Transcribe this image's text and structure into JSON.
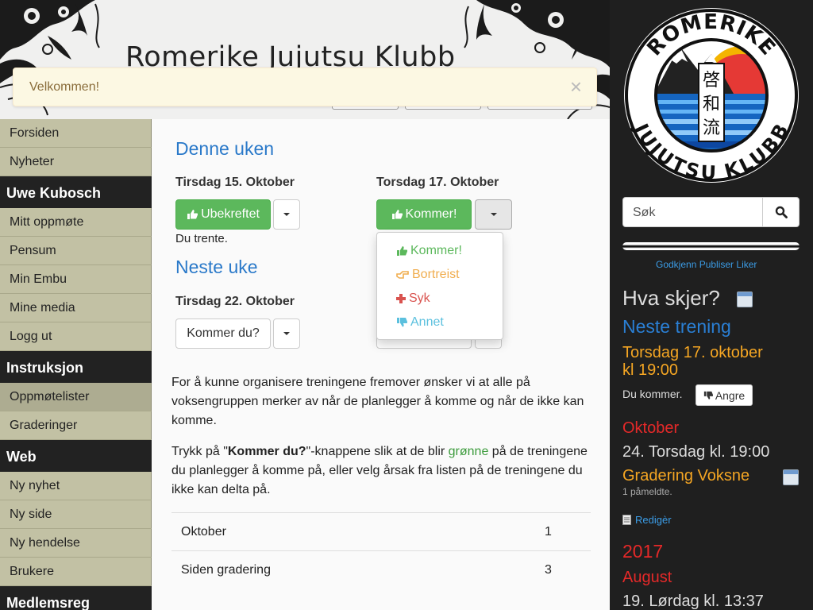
{
  "header": {
    "site_title": "Romerike Jujutsu Klubb"
  },
  "alert": {
    "message": "Velkommen!",
    "close_symbol": "×"
  },
  "leftnav": {
    "top_items": [
      "Forsiden",
      "Nyheter"
    ],
    "sections": [
      {
        "title": "Uwe Kubosch",
        "items": [
          "Mitt oppmøte",
          "Pensum",
          "Min Embu",
          "Mine media",
          "Logg ut"
        ]
      },
      {
        "title": "Instruksjon",
        "items": [
          "Oppmøtelister",
          "Graderinger"
        ]
      },
      {
        "title": "Web",
        "items": [
          "Ny nyhet",
          "Ny side",
          "Ny hendelse",
          "Brukere"
        ]
      },
      {
        "title": "Medlemsreg"
      }
    ],
    "active_item": "Oppmøtelister"
  },
  "main": {
    "this_week": "Denne uken",
    "tuesday_15": "Tirsdag 15. Oktober",
    "thursday_17": "Torsdag 17. Oktober",
    "btn_unconfirmed": "Ubekreftet",
    "btn_coming": "Kommer!",
    "trained_text": "Du trente.",
    "next_week": "Neste uke",
    "tuesday_22": "Tirsdag 22. Oktober",
    "btn_coming_q": "Kommer du?",
    "dropdown": {
      "coming": "Kommer!",
      "away": "Bortreist",
      "sick": "Syk",
      "other": "Annet"
    },
    "para1": "For å kunne organisere treningene fremover ønsker vi at alle på voksengruppen merker av når de planlegger å komme og når de ikke kan komme.",
    "para2": {
      "prefix": "Trykk på \"",
      "bold": "Kommer du?",
      "mid": "\"-knappene slik at de blir ",
      "green_word": "grønne",
      "suffix": " på de treningene du planlegger å komme på, eller velg årsak fra listen på de treningene du ikke kan delta på."
    },
    "stats": [
      {
        "label": "Oktober",
        "value": "1"
      },
      {
        "label": "Siden gradering",
        "value": "3"
      }
    ]
  },
  "sidebar": {
    "logo": {
      "top_text": "ROMERIKE",
      "bottom_text": "JUJUTSU KLUBB",
      "kanji": [
        "啓",
        "和",
        "流"
      ]
    },
    "search_placeholder": "Søk",
    "fb_links": "Godkjenn Publiser Liker",
    "whats_on": "Hva skjer?",
    "next_training": "Neste trening",
    "next_training_time_1": "Torsdag 17. oktober",
    "next_training_time_2": "kl 19:00",
    "you_coming": "Du kommer.",
    "undo_button": "Angre",
    "month": "Oktober",
    "event_line": "24. Torsdag kl. 19:00",
    "event_title": "Gradering Voksne",
    "registered": "1 påmeldte.",
    "edit_link": "Redigèr",
    "year": "2017",
    "month2": "August",
    "event_line2": "19. Lørdag kl. 13:37"
  },
  "colors": {
    "accent_blue": "#2a79c9",
    "success_green": "#5cb85c",
    "warning_orange": "#f5a623",
    "danger_red": "#e52929",
    "info_blue": "#5bc0de",
    "nav_olive": "#c2c1a4",
    "dark": "#222222"
  },
  "icons": [
    "thumbs-up-icon",
    "thumbs-down-icon",
    "hand-point-icon",
    "plus-icon",
    "caret-down-icon",
    "search-icon",
    "calendar-icon",
    "document-icon",
    "close-icon"
  ]
}
